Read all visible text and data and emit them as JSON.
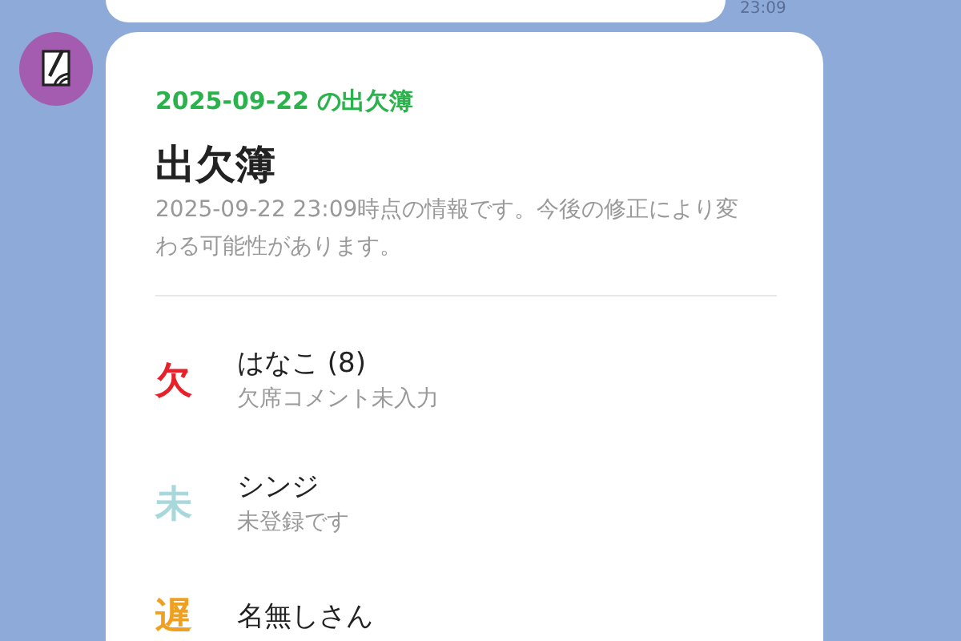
{
  "previous_message": {
    "time": "23:09"
  },
  "message": {
    "subtitle": "2025-09-22 の出欠簿",
    "title": "出欠簿",
    "note": "2025-09-22 23:09時点の情報です。今後の修正により変わる可能性があります。",
    "entries": [
      {
        "status": "欠",
        "color": "#e8202a",
        "name": "はなこ (8)",
        "detail": "欠席コメント未入力"
      },
      {
        "status": "未",
        "color": "#a8d8dc",
        "name": "シンジ",
        "detail": "未登録です"
      },
      {
        "status": "遅",
        "color": "#f0a020",
        "name": "名無しさん"
      }
    ]
  }
}
